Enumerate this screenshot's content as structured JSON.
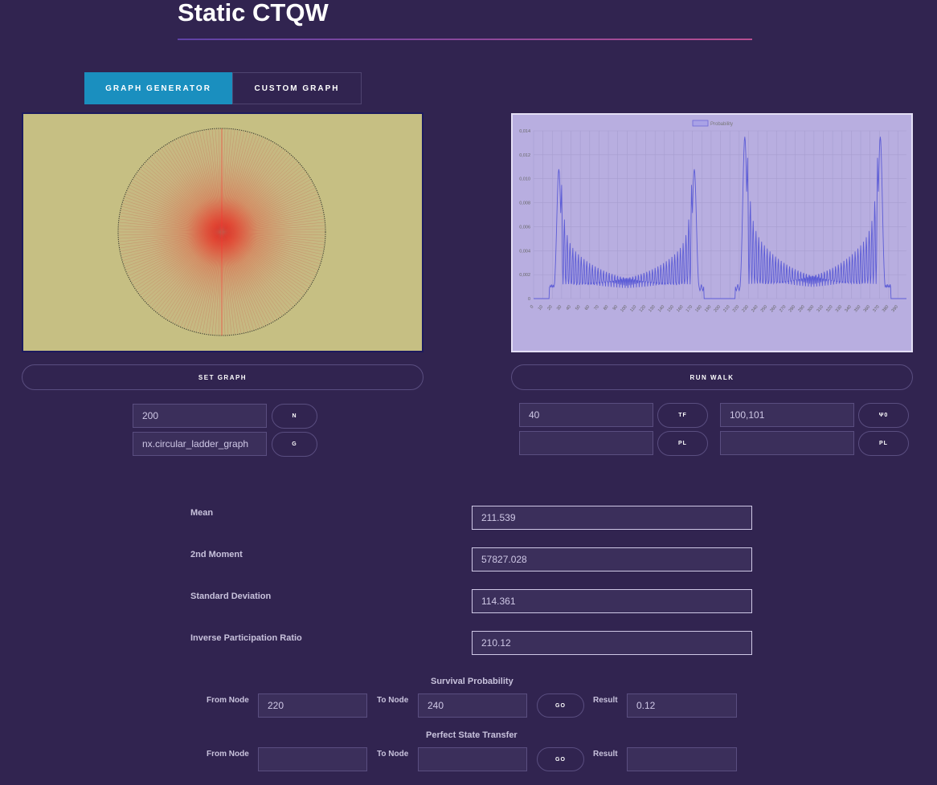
{
  "header": {
    "title": "Static CTQW"
  },
  "tabs": [
    {
      "label": "GRAPH GENERATOR",
      "active": true
    },
    {
      "label": "CUSTOM GRAPH",
      "active": false
    }
  ],
  "buttons": {
    "set_graph": "SET GRAPH",
    "run_walk": "RUN WALK"
  },
  "graph_params": {
    "n_value": "200",
    "n_label": "N",
    "g_value": "nx.circular_ladder_graph",
    "g_label": "G"
  },
  "walk_params": {
    "tf_value": "40",
    "tf_label": "TF",
    "psi0_value": "100,101",
    "psi0_label": "Ψ0",
    "pl1_value": "",
    "pl1_label": "PL",
    "pl2_value": "",
    "pl2_label": "PL"
  },
  "stats": [
    {
      "label": "Mean",
      "value": "211.539"
    },
    {
      "label": "2nd Moment",
      "value": "57827.028"
    },
    {
      "label": "Standard Deviation",
      "value": "114.361"
    },
    {
      "label": "Inverse Participation Ratio",
      "value": "210.12"
    }
  ],
  "survival": {
    "title": "Survival Probability",
    "from_label": "From Node",
    "from_value": "220",
    "to_label": "To Node",
    "to_value": "240",
    "go_label": "GO",
    "result_label": "Result",
    "result_value": "0.12"
  },
  "pst": {
    "title": "Perfect State Transfer",
    "from_label": "From Node",
    "from_value": "",
    "to_label": "To Node",
    "to_value": "",
    "go_label": "GO",
    "result_label": "Result",
    "result_value": ""
  },
  "colors": {
    "background": "#312450",
    "accent": "#1a8fbf",
    "graph_bg": "#c6bf83",
    "chart_bg": "#b8aee0",
    "line": "#5c5cd6"
  },
  "chart_data": {
    "type": "line",
    "series": [
      {
        "name": "Probability"
      }
    ],
    "legend_position": "top",
    "grid": true,
    "ylim": [
      0,
      0.014
    ],
    "y_ticks": [
      "0",
      "0,002",
      "0,004",
      "0,006",
      "0,008",
      "0,010",
      "0,012",
      "0,014"
    ],
    "x_ticks": [
      "0",
      "10",
      "20",
      "30",
      "40",
      "50",
      "60",
      "70",
      "80",
      "90",
      "100",
      "110",
      "120",
      "130",
      "140",
      "150",
      "160",
      "170",
      "180",
      "190",
      "200",
      "210",
      "220",
      "230",
      "240",
      "250",
      "260",
      "270",
      "280",
      "290",
      "300",
      "310",
      "320",
      "330",
      "340",
      "350",
      "360",
      "370",
      "380",
      "390"
    ],
    "xlim": [
      0,
      399
    ],
    "peaks": [
      {
        "x": 27,
        "y": 0.0108,
        "dir": 1,
        "gap": 0.0045
      },
      {
        "x": 172,
        "y": 0.0108,
        "dir": -1,
        "gap": 0.0045
      },
      {
        "x": 226,
        "y": 0.0135,
        "dir": 1,
        "gap": 0.0058
      },
      {
        "x": 371,
        "y": 0.0135,
        "dir": -1,
        "gap": 0.0058
      }
    ],
    "baseline_levels": [
      0.0018,
      0.0022
    ]
  }
}
